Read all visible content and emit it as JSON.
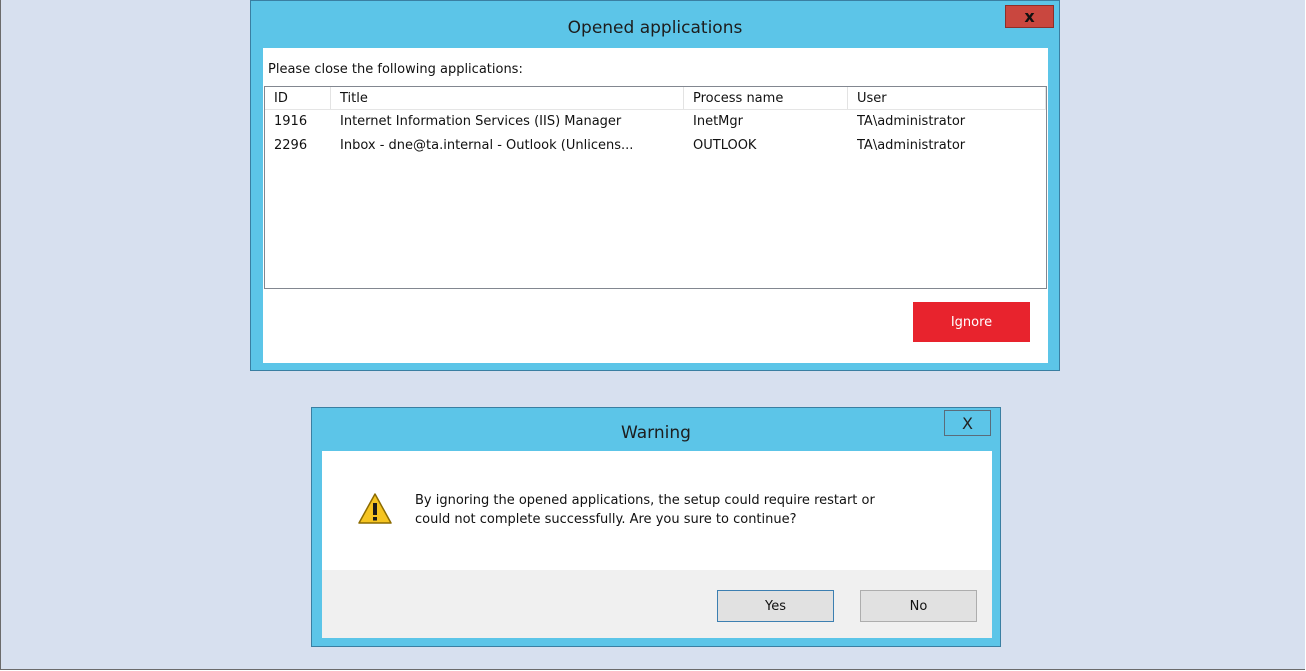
{
  "opened_apps": {
    "title": "Opened applications",
    "close_glyph": "x",
    "instruction": "Please close the following applications:",
    "columns": [
      "ID",
      "Title",
      "Process name",
      "User"
    ],
    "rows": [
      [
        "1916",
        "Internet Information Services (IIS) Manager",
        "InetMgr",
        "TA\\administrator"
      ],
      [
        "2296",
        "Inbox - dne@ta.internal - Outlook (Unlicens...",
        "OUTLOOK",
        "TA\\administrator"
      ]
    ],
    "ignore_label": "Ignore",
    "colors": {
      "titlebar": "#5cc5e8",
      "close_button": "#c9473f",
      "ignore_button": "#e8232d"
    }
  },
  "warning": {
    "title": "Warning",
    "close_glyph": "X",
    "icon": "warning-triangle-icon",
    "message_line1": "By ignoring the opened applications, the setup could require restart or",
    "message_line2": "could not complete successfully. Are you sure to continue?",
    "yes_label": "Yes",
    "no_label": "No"
  }
}
